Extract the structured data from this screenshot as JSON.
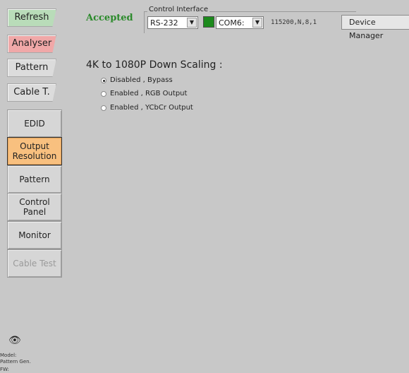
{
  "top_buttons": {
    "refresh": "Refresh",
    "analyser": "Analyser",
    "pattern": "Pattern",
    "cable": "Cable T."
  },
  "status_text": "Accepted",
  "control_interface": {
    "label": "Control Interface",
    "interface_select": "RS-232",
    "port_select": "COM6:",
    "serial_settings": "115200,N,8,1",
    "device_manager_label": "Device Manager"
  },
  "side_nav": {
    "edid": "EDID",
    "output_res_line1": "Output",
    "output_res_line2": "Resolution",
    "pattern": "Pattern",
    "control_line1": "Control",
    "control_line2": "Panel",
    "monitor": "Monitor",
    "cable_test": "Cable Test"
  },
  "main": {
    "heading": "4K to 1080P Down Scaling :",
    "options": [
      {
        "label": "Disabled , Bypass",
        "selected": true
      },
      {
        "label": "Enabled , RGB Output",
        "selected": false
      },
      {
        "label": "Enabled , YCbCr Output",
        "selected": false
      }
    ]
  },
  "footer": {
    "model_label": "Model:",
    "model_value": "Pattern Gen.",
    "fw_label": "FW:"
  },
  "colors": {
    "background": "#c8c8c8",
    "accepted": "#2b8a2b",
    "active_tab": "#f8c07f",
    "refresh": "#b9dcb9",
    "analyser": "#f0a8a8",
    "led": "#1c8a1c"
  }
}
